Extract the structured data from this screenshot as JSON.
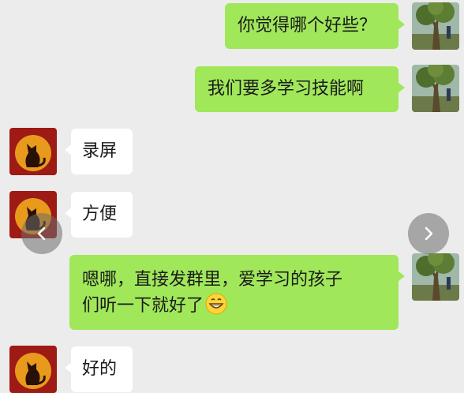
{
  "chat": {
    "messages": [
      {
        "sender": "me",
        "text": "你觉得哪个好些？"
      },
      {
        "sender": "me",
        "text": "我们要多学习技能啊"
      },
      {
        "sender": "other",
        "text": "录屏"
      },
      {
        "sender": "other",
        "text": "方便"
      },
      {
        "sender": "me",
        "line1": "嗯哪，直接发群里，爱学习的孩子",
        "line2": "们听一下就好了",
        "emoji": "grin-emoji"
      },
      {
        "sender": "other",
        "text": "好的"
      }
    ]
  },
  "colors": {
    "background": "#ececec",
    "my_bubble": "#a0e75a",
    "their_bubble": "#ffffff",
    "their_avatar_bg": "#9e1a14",
    "their_avatar_ring": "#e89a1c"
  },
  "icons": {
    "prev": "chevron-left-icon",
    "next": "chevron-right-icon"
  }
}
